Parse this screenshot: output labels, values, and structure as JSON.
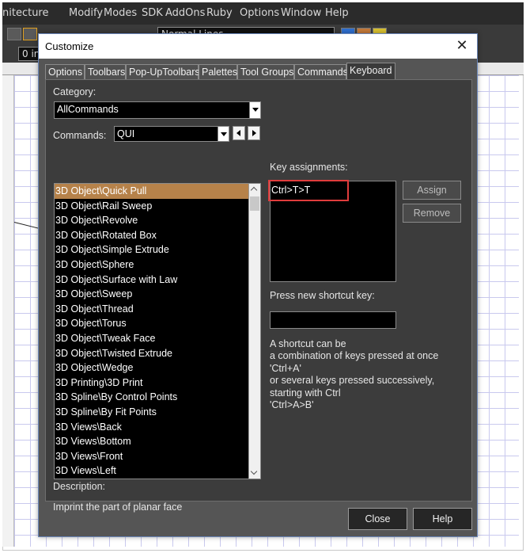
{
  "app": {
    "menubar": [
      "nitecture",
      "Modify",
      "Modes",
      "SDK",
      "AddOns",
      "Ruby",
      "Options",
      "Window",
      "Help"
    ],
    "layer_value": "Normal Lines",
    "units_value": "0 in"
  },
  "dialog": {
    "title": "Customize",
    "close_glyph": "✕",
    "tabs": [
      {
        "label": "Options",
        "hotkey": "O",
        "active": false
      },
      {
        "label": "Toolbars",
        "hotkey": "b",
        "active": false
      },
      {
        "label": "Pop-UpToolbars",
        "hotkey": "",
        "active": false
      },
      {
        "label": "Palettes",
        "hotkey": "",
        "active": false
      },
      {
        "label": "Tool Groups",
        "hotkey": "G",
        "active": false
      },
      {
        "label": "Commands",
        "hotkey": "C",
        "active": false
      },
      {
        "label": "Keyboard",
        "hotkey": "",
        "active": true
      }
    ],
    "category_label": "Category:",
    "category_value": "AllCommands",
    "commands_label": "Commands:",
    "commands_filter": "QUI",
    "commands": [
      "3D Object\\Quick Pull",
      "3D Object\\Rail Sweep",
      "3D Object\\Revolve",
      "3D Object\\Rotated Box",
      "3D Object\\Simple Extrude",
      "3D Object\\Sphere",
      "3D Object\\Surface with Law",
      "3D Object\\Sweep",
      "3D Object\\Thread",
      "3D Object\\Torus",
      "3D Object\\Tweak Face",
      "3D Object\\Twisted Extrude",
      "3D Object\\Wedge",
      "3D Printing\\3D Print",
      "3D Spline\\By Control Points",
      "3D Spline\\By Fit Points",
      "3D Views\\Back",
      "3D Views\\Bottom",
      "3D Views\\Front",
      "3D Views\\Left"
    ],
    "selected_command_index": 0,
    "key_assignments_label": "Key assignments:",
    "key_assignments": [
      "Ctrl>T>T"
    ],
    "assign_button": "Assign",
    "remove_button": "Remove",
    "press_shortcut_label": "Press new shortcut key:",
    "shortcut_value": "",
    "help_lines": [
      "A shortcut can be",
      "a combination of keys pressed at once",
      "'Ctrl+A'",
      "or several keys pressed successively,",
      "starting with Ctrl",
      "'Ctrl>A>B'"
    ],
    "description_label": "Description:",
    "description_text": "Imprint the part of planar face",
    "close_button": "Close",
    "help_button": "Help"
  },
  "colors": {
    "dialog_bg": "#555555",
    "panel_bg": "#3c3c3c",
    "list_bg": "#000000",
    "selection": "#b6824a",
    "highlight_border": "#e03c3c",
    "grid_line": "#c9c9ee"
  }
}
